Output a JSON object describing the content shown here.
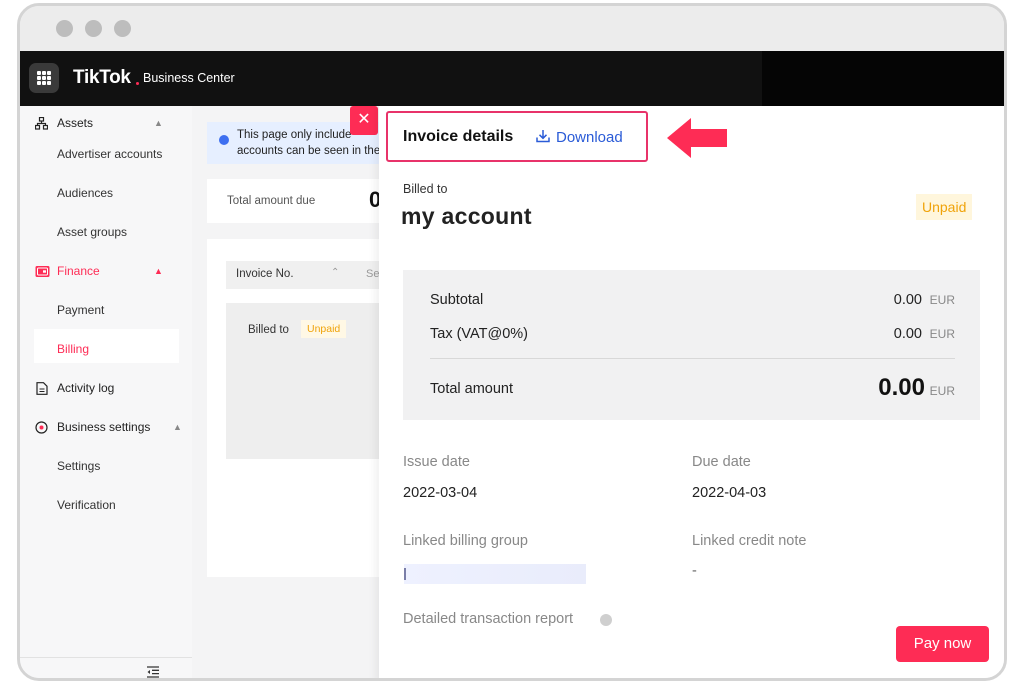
{
  "window": {
    "control_dots": [
      "close",
      "minimize",
      "maximize"
    ]
  },
  "topbar": {
    "brand": "TikTok",
    "brand_sub": "Business Center",
    "app_menu_icon": "grid-icon"
  },
  "sidebar": {
    "items": [
      {
        "label": "Assets",
        "icon": "assets-icon",
        "type": "section",
        "expanded": true
      },
      {
        "label": "Advertiser accounts",
        "type": "sub"
      },
      {
        "label": "Audiences",
        "type": "sub"
      },
      {
        "label": "Asset groups",
        "type": "sub"
      },
      {
        "label": "Finance",
        "icon": "wallet-icon",
        "type": "section",
        "expanded": true,
        "active": true
      },
      {
        "label": "Payment",
        "type": "sub"
      },
      {
        "label": "Billing",
        "type": "sub",
        "selected": true
      },
      {
        "label": "Activity log",
        "icon": "document-icon",
        "type": "section"
      },
      {
        "label": "Business settings",
        "icon": "settings-icon",
        "type": "section",
        "expanded": true
      },
      {
        "label": "Settings",
        "type": "sub"
      },
      {
        "label": "Verification",
        "type": "sub"
      }
    ],
    "collapse_icon": "collapse-sidebar-icon"
  },
  "background_page": {
    "banner_text_line1": "This page only include",
    "banner_text_line2": "accounts can be seen in the",
    "total_due_label": "Total amount due",
    "total_due_value": "0",
    "table_header_invoice": "Invoice No.",
    "table_header_partial": "Se",
    "row_billed_to": "Billed to",
    "row_status": "Unpaid"
  },
  "panel": {
    "title": "Invoice details",
    "download_label": "Download",
    "billed_to_label": "Billed to",
    "account_name": "my account",
    "status": "Unpaid",
    "summary": {
      "subtotal_label": "Subtotal",
      "subtotal_value": "0.00",
      "tax_label": "Tax (VAT@0%)",
      "tax_value": "0.00",
      "total_label": "Total amount",
      "total_value": "0.00",
      "currency": "EUR"
    },
    "issue_date_label": "Issue date",
    "issue_date": "2022-03-04",
    "due_date_label": "Due date",
    "due_date": "2022-04-03",
    "linked_billing_group_label": "Linked billing group",
    "linked_credit_note_label": "Linked credit note",
    "linked_credit_note_value": "-",
    "detailed_report_label": "Detailed transaction report",
    "pay_button": "Pay now"
  },
  "colors": {
    "brand_accent": "#fe2c55",
    "link_blue": "#2a5bd7",
    "status_unpaid": "#f0a30a",
    "highlight_border": "#e8336a"
  }
}
